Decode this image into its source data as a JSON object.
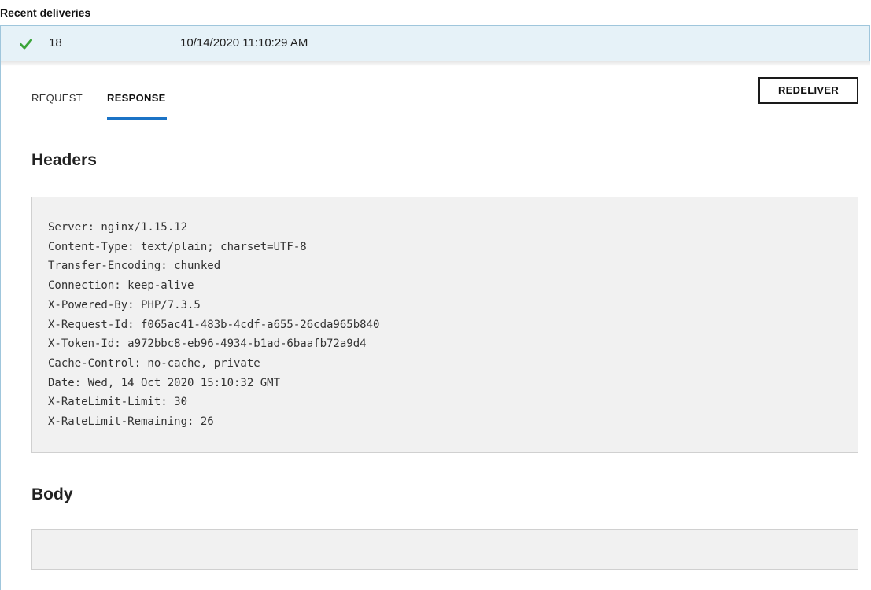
{
  "section_title": "Recent deliveries",
  "delivery": {
    "status_icon": "check-icon",
    "status_color": "#3aa53a",
    "id": "18",
    "timestamp": "10/14/2020 11:10:29 AM"
  },
  "tabs": [
    {
      "label": "REQUEST",
      "active": false
    },
    {
      "label": "RESPONSE",
      "active": true
    }
  ],
  "redeliver_label": "REDELIVER",
  "headers_heading": "Headers",
  "headers": [
    "Server: nginx/1.15.12",
    "Content-Type: text/plain; charset=UTF-8",
    "Transfer-Encoding: chunked",
    "Connection: keep-alive",
    "X-Powered-By: PHP/7.3.5",
    "X-Request-Id: f065ac41-483b-4cdf-a655-26cda965b840",
    "X-Token-Id: a972bbc8-eb96-4934-b1ad-6baafb72a9d4",
    "Cache-Control: no-cache, private",
    "Date: Wed, 14 Oct 2020 15:10:32 GMT",
    "X-RateLimit-Limit: 30",
    "X-RateLimit-Remaining: 26"
  ],
  "body_heading": "Body",
  "body_content": "",
  "colors": {
    "accent": "#1b73c6",
    "row_background": "#e6f2f8",
    "code_background": "#f1f1f1"
  }
}
